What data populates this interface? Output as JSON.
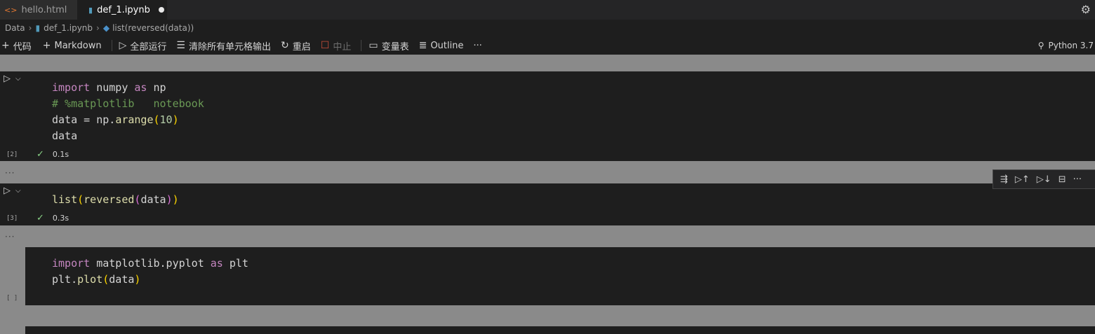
{
  "tabs": [
    {
      "label": "hello.html",
      "icon": "html-file-icon"
    },
    {
      "label": "def_1.ipynb",
      "icon": "notebook-file-icon",
      "modified": true
    }
  ],
  "breadcrumb": {
    "root": "Data",
    "file": "def_1.ipynb",
    "symbol": "list(reversed(data))"
  },
  "toolbar": {
    "add_code": "代码",
    "add_markdown": "Markdown",
    "run_all": "全部运行",
    "clear_outputs": "清除所有单元格输出",
    "restart": "重启",
    "interrupt": "中止",
    "variables": "变量表",
    "outline": "Outline",
    "more": "···",
    "kernel": "Python 3.7"
  },
  "cells": [
    {
      "exec_count": "[2]",
      "duration": "0.1s",
      "lines": [
        "import numpy as np",
        "# %matplotlib   notebook",
        "data = np.arange(10)",
        "data"
      ]
    },
    {
      "exec_count": "[3]",
      "duration": "0.3s",
      "lines": [
        "list(reversed(data))"
      ]
    },
    {
      "exec_count": "[ ]",
      "lines": [
        "import matplotlib.pyplot as plt",
        "plt.plot(data)"
      ]
    }
  ],
  "output_ellipsis": "···",
  "colors": {
    "editor_bg": "#1e1e1e",
    "gutter_bg": "#8a8a8a",
    "keyword": "#c586c0",
    "comment": "#6a9955",
    "success": "#89d185"
  }
}
